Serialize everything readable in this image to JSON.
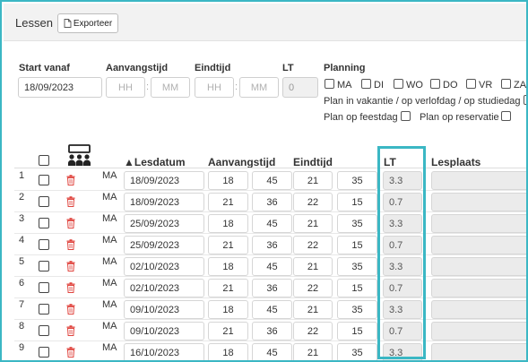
{
  "header": {
    "title": "Lessen",
    "export_label": "Exporteer"
  },
  "form": {
    "start_label": "Start vanaf",
    "start_value": "18/09/2023",
    "begin_label": "Aanvangstijd",
    "begin_hh": "HH",
    "begin_mm": "MM",
    "end_label": "Eindtijd",
    "end_hh": "HH",
    "end_mm": "MM",
    "lt_label": "LT",
    "lt_value": "0",
    "planning_label": "Planning",
    "days": [
      "MA",
      "DI",
      "WO",
      "DO",
      "VR",
      "ZA"
    ],
    "plan_vacation": "Plan in vakantie / op verlofdag / op studiedag",
    "plan_holiday": "Plan op feestdag",
    "plan_reservation": "Plan op reservatie"
  },
  "table": {
    "headers": {
      "date": "▲Lesdatum",
      "begin": "Aanvangstijd",
      "end": "Eindtijd",
      "lt": "LT",
      "place": "Lesplaats"
    },
    "rows": [
      {
        "num": "1",
        "day": "MA",
        "date": "18/09/2023",
        "bh": "18",
        "bm": "45",
        "eh": "21",
        "em": "35",
        "lt": "3.3"
      },
      {
        "num": "2",
        "day": "MA",
        "date": "18/09/2023",
        "bh": "21",
        "bm": "36",
        "eh": "22",
        "em": "15",
        "lt": "0.7"
      },
      {
        "num": "3",
        "day": "MA",
        "date": "25/09/2023",
        "bh": "18",
        "bm": "45",
        "eh": "21",
        "em": "35",
        "lt": "3.3"
      },
      {
        "num": "4",
        "day": "MA",
        "date": "25/09/2023",
        "bh": "21",
        "bm": "36",
        "eh": "22",
        "em": "15",
        "lt": "0.7"
      },
      {
        "num": "5",
        "day": "MA",
        "date": "02/10/2023",
        "bh": "18",
        "bm": "45",
        "eh": "21",
        "em": "35",
        "lt": "3.3"
      },
      {
        "num": "6",
        "day": "MA",
        "date": "02/10/2023",
        "bh": "21",
        "bm": "36",
        "eh": "22",
        "em": "15",
        "lt": "0.7"
      },
      {
        "num": "7",
        "day": "MA",
        "date": "09/10/2023",
        "bh": "18",
        "bm": "45",
        "eh": "21",
        "em": "35",
        "lt": "3.3"
      },
      {
        "num": "8",
        "day": "MA",
        "date": "09/10/2023",
        "bh": "21",
        "bm": "36",
        "eh": "22",
        "em": "15",
        "lt": "0.7"
      },
      {
        "num": "9",
        "day": "MA",
        "date": "16/10/2023",
        "bh": "18",
        "bm": "45",
        "eh": "21",
        "em": "35",
        "lt": "3.3"
      }
    ]
  },
  "colors": {
    "highlight": "#3bb7c4",
    "trash": "#e0443e"
  }
}
